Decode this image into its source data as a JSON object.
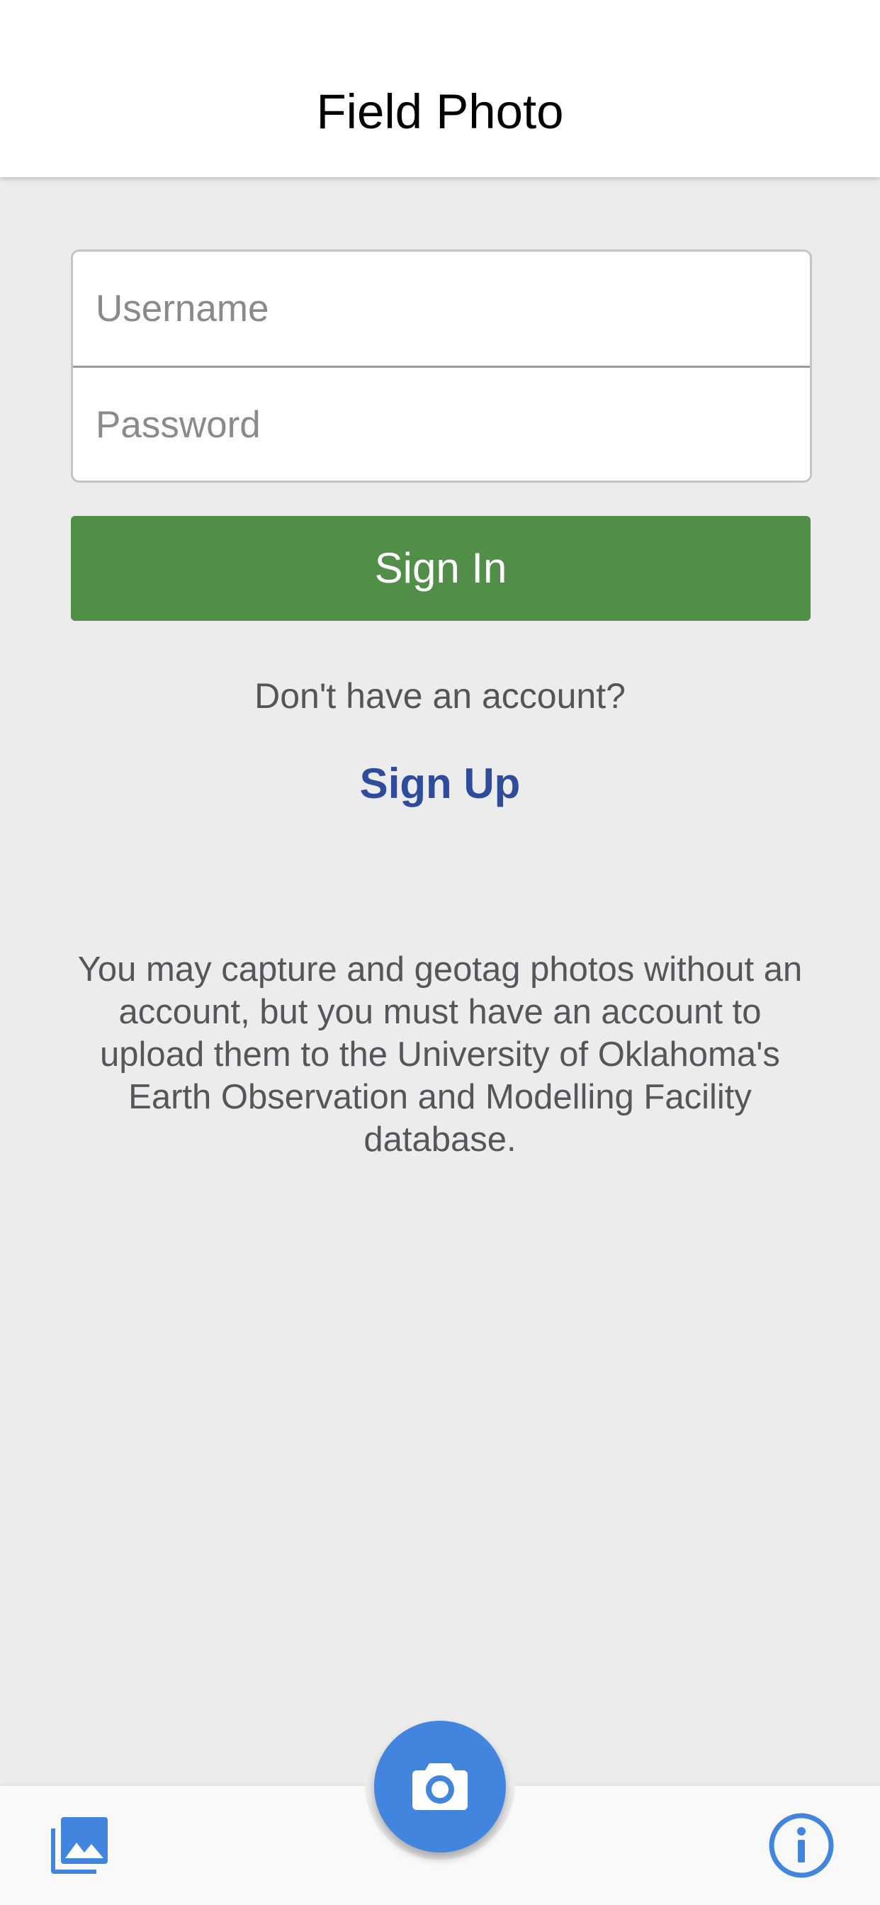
{
  "header": {
    "title": "Field Photo"
  },
  "login_form": {
    "username_placeholder": "Username",
    "username_value": "",
    "password_placeholder": "Password",
    "password_value": "",
    "sign_in_label": "Sign In"
  },
  "signup": {
    "prompt": "Don't have an account?",
    "link_label": "Sign Up"
  },
  "info": {
    "message": "You may capture and geotag photos without an account, but you must have an account to upload them to the University of Oklahoma's Earth Observation and Modelling Facility database."
  },
  "tabbar": {
    "gallery_icon": "gallery-icon",
    "camera_icon": "camera-icon",
    "info_icon": "info-icon"
  },
  "colors": {
    "background": "#ececed",
    "sign_in_button": "#518e47",
    "sign_up_link": "#2f4c9c",
    "accent_blue": "#4285df"
  }
}
